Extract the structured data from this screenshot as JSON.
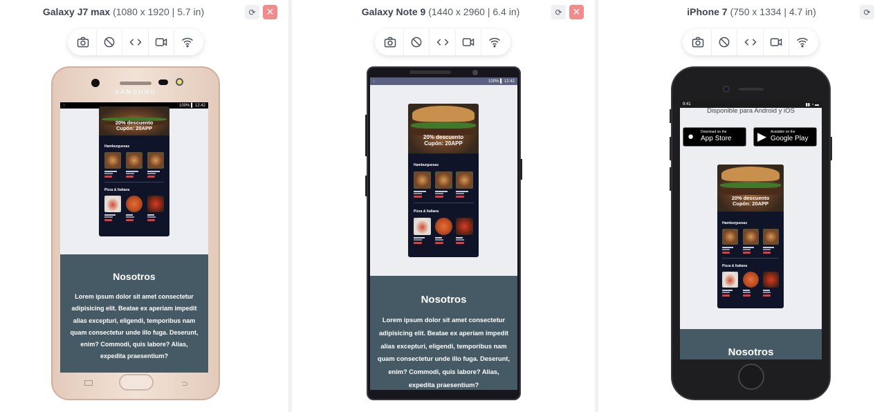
{
  "devices": [
    {
      "name": "Galaxy J7 max",
      "specs": "(1080 x 1920 | 5.7 in)",
      "brand_text": "SAMSUNG",
      "status_right": "100% ▌ 12:42",
      "promo_line1": "20% descuento",
      "promo_line2": "Cupón: 20APP",
      "section1": "Hamburguesas",
      "section2": "Pizza & Italiana",
      "about_title": "Nosotros",
      "about_text": "Lorem ipsum dolor sit amet consectetur adipisicing elit. Beatae ex aperiam impedit alias excepturi, eligendi, temporibus nam quam consectetur unde illo fuga. Deserunt, enim? Commodi, quis labore? Alias, expedita praesentium?"
    },
    {
      "name": "Galaxy Note 9",
      "specs": "(1440 x 2960 | 6.4 in)",
      "status_right": "100% ▌ 12:42",
      "promo_line1": "20% descuento",
      "promo_line2": "Cupón: 20APP",
      "section1": "Hamburguesas",
      "section2": "Pizza & Italiana",
      "about_title": "Nosotros",
      "about_text": "Lorem ipsum dolor sit amet consectetur adipisicing elit. Beatae ex aperiam impedit alias excepturi, eligendi, temporibus nam quam consectetur unde illo fuga. Deserunt, enim? Commodi, quis labore? Alias, expedita praesentium?"
    },
    {
      "name": "iPhone 7",
      "specs": "(750 x 1334 | 4.7 in)",
      "status_left": "9:41",
      "available_text": "Disponible para Android y iOS",
      "appstore_small": "Download on the",
      "appstore_big": "App Store",
      "gplay_small": "Available on the",
      "gplay_big": "Google Play",
      "promo_line1": "20% descuento",
      "promo_line2": "Cupón: 20APP",
      "section1": "Hamburguesas",
      "section2": "Pizza & Italiana",
      "about_title": "Nosotros"
    }
  ],
  "toolbar_icons": [
    "camera-icon",
    "rotate-icon",
    "code-icon",
    "video-icon",
    "wifi-icon"
  ],
  "colors": {
    "close_button": "#f28b8b",
    "about_bg": "#455a64",
    "app_bg": "#101429",
    "order_button": "#e23c3c"
  }
}
